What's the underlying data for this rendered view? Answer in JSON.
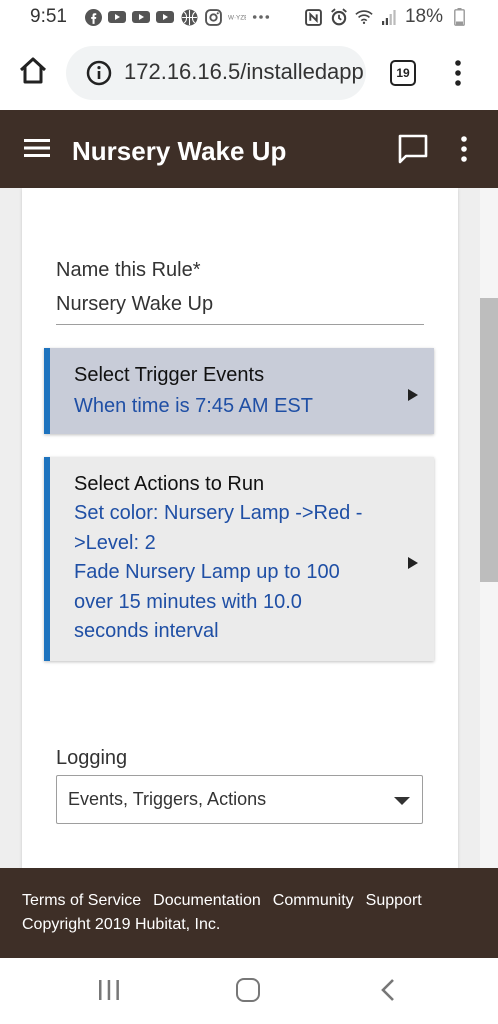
{
  "status_bar": {
    "time": "9:51",
    "battery": "18%",
    "left_icons": [
      "facebook-icon",
      "youtube-icon",
      "youtube-icon",
      "youtube-icon",
      "basketball-icon",
      "instagram-icon",
      "wyze-icon",
      "more-dots-icon"
    ],
    "right_icons": [
      "nfc-icon",
      "alarm-icon",
      "wifi-icon",
      "signal-icon",
      "battery-icon"
    ]
  },
  "browser": {
    "url": "172.16.16.5/installedapp",
    "tab_count": "19"
  },
  "header": {
    "title": "Nursery Wake Up"
  },
  "form": {
    "name_label": "Name this Rule*",
    "name_value": "Nursery Wake Up",
    "trigger": {
      "title": "Select Trigger Events",
      "description": "When time is 7:45 AM EST"
    },
    "actions": {
      "title": "Select Actions to Run",
      "description": "Set color: Nursery Lamp ->Red  -\n>Level: 2\nFade Nursery Lamp up to 100\nover 15 minutes with 10.0\nseconds interval"
    },
    "logging": {
      "label": "Logging",
      "value": "Events, Triggers, Actions"
    }
  },
  "footer": {
    "links": [
      "Terms of Service",
      "Documentation",
      "Community",
      "Support"
    ],
    "copyright": "Copyright 2019 Hubitat, Inc."
  },
  "colors": {
    "header_bg": "#3e2f27",
    "accent": "#1e73be",
    "link_text": "#1f4fa5",
    "trigger_bg": "#c8ccd8"
  }
}
